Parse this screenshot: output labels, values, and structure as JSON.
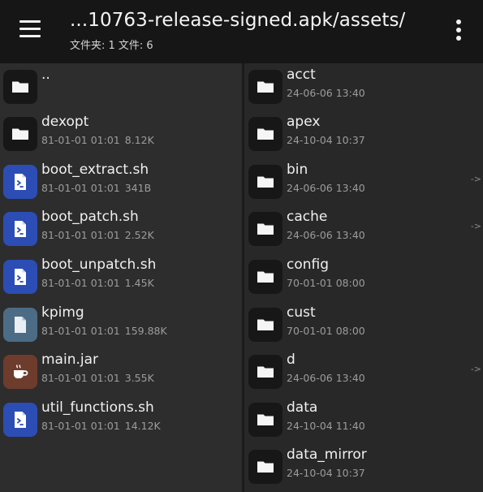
{
  "toolbar": {
    "title": "...10763-release-signed.apk/assets/",
    "subtitle": "文件夹: 1  文件: 6"
  },
  "left_pane": {
    "items": [
      {
        "name": "..",
        "date": "",
        "size": "",
        "type": "folder",
        "icon": "folder-icon"
      },
      {
        "name": "dexopt",
        "date": "81-01-01 01:01",
        "size": "8.12K",
        "type": "folder",
        "icon": "folder-icon"
      },
      {
        "name": "boot_extract.sh",
        "date": "81-01-01 01:01",
        "size": "341B",
        "type": "script",
        "icon": "script-icon"
      },
      {
        "name": "boot_patch.sh",
        "date": "81-01-01 01:01",
        "size": "2.52K",
        "type": "script",
        "icon": "script-icon"
      },
      {
        "name": "boot_unpatch.sh",
        "date": "81-01-01 01:01",
        "size": "1.45K",
        "type": "script",
        "icon": "script-icon"
      },
      {
        "name": "kpimg",
        "date": "81-01-01 01:01",
        "size": "159.88K",
        "type": "file",
        "icon": "file-icon"
      },
      {
        "name": "main.jar",
        "date": "81-01-01 01:01",
        "size": "3.55K",
        "type": "jar",
        "icon": "coffee-cup-icon"
      },
      {
        "name": "util_functions.sh",
        "date": "81-01-01 01:01",
        "size": "14.12K",
        "type": "script",
        "icon": "script-icon"
      }
    ]
  },
  "right_pane": {
    "items": [
      {
        "name": "acct",
        "date": "24-06-06 13:40",
        "arrow": "",
        "icon": "folder-icon"
      },
      {
        "name": "apex",
        "date": "24-10-04 10:37",
        "arrow": "",
        "icon": "folder-icon"
      },
      {
        "name": "bin",
        "date": "24-06-06 13:40",
        "arrow": "->",
        "icon": "folder-icon"
      },
      {
        "name": "cache",
        "date": "24-06-06 13:40",
        "arrow": "->",
        "icon": "folder-icon"
      },
      {
        "name": "config",
        "date": "70-01-01 08:00",
        "arrow": "",
        "icon": "folder-icon"
      },
      {
        "name": "cust",
        "date": "70-01-01 08:00",
        "arrow": "",
        "icon": "folder-icon"
      },
      {
        "name": "d",
        "date": "24-06-06 13:40",
        "arrow": "->",
        "icon": "folder-icon"
      },
      {
        "name": "data",
        "date": "24-10-04 11:40",
        "arrow": "",
        "icon": "folder-icon"
      },
      {
        "name": "data_mirror",
        "date": "24-10-04 10:37",
        "arrow": "",
        "icon": "folder-icon"
      }
    ]
  },
  "icons": {
    "menu": "hamburger-menu-icon",
    "more": "more-vert-icon"
  },
  "colors": {
    "toolbar_bg": "#161616",
    "left_pane_bg": "#2d2d2d",
    "right_pane_bg": "#282828",
    "script_icon_bg": "#2b4db4",
    "file_icon_bg": "#4c6c86",
    "jar_icon_bg": "#6e3c2c"
  }
}
